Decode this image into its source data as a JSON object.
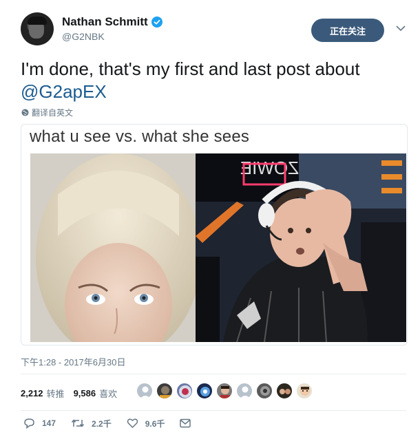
{
  "user": {
    "display_name": "Nathan Schmitt",
    "handle": "@G2NBK",
    "verified": true,
    "follow_label": "正在关注"
  },
  "tweet": {
    "text_part1": "I'm done, that's my first and last post about ",
    "mention": "@G2apEX",
    "translate_label": "翻译自英文",
    "timestamp": "下午1:28 - 2017年6月30日"
  },
  "media": {
    "caption": "what u see vs. what she sees",
    "left_panel": "photo of blonde woman",
    "right_panel": "photo of esports player with headset, hand on head"
  },
  "stats": {
    "retweets_count": "2,212",
    "retweets_label": "转推",
    "likes_count": "9,586",
    "likes_label": "喜欢"
  },
  "liker_avatars": [
    "avatar-1",
    "avatar-2",
    "avatar-3",
    "avatar-4",
    "avatar-5",
    "avatar-6",
    "avatar-7",
    "avatar-8",
    "avatar-9"
  ],
  "actions": {
    "replies": "147",
    "retweets": "2.2千",
    "likes": "9.6千"
  },
  "colors": {
    "follow_button": "#3b5a7b",
    "mention": "#1b5b8f",
    "verified": "#1da1f2",
    "muted": "#657786"
  }
}
